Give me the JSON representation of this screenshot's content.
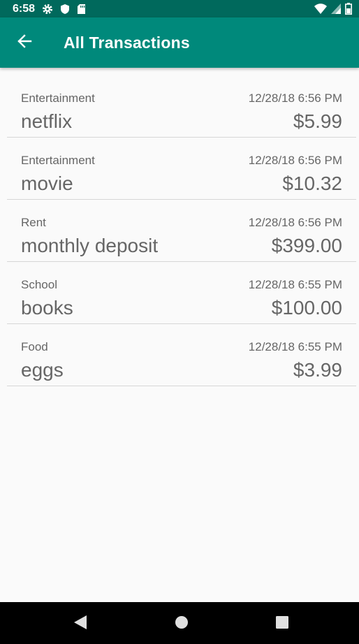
{
  "status_bar": {
    "time": "6:58",
    "left_icons": [
      "gear-icon",
      "shield-icon",
      "sd-card-icon"
    ],
    "right_icons": [
      "wifi-icon",
      "signal-icon",
      "battery-icon"
    ]
  },
  "app_bar": {
    "title": "All Transactions",
    "back_icon": "arrow-back-icon",
    "color": "#00897b",
    "status_color": "#00695c"
  },
  "transactions": [
    {
      "category": "Entertainment",
      "date": "12/28/18 6:56 PM",
      "name": "netflix",
      "amount": "$5.99"
    },
    {
      "category": "Entertainment",
      "date": "12/28/18 6:56 PM",
      "name": "movie",
      "amount": "$10.32"
    },
    {
      "category": "Rent",
      "date": "12/28/18 6:56 PM",
      "name": "monthly deposit",
      "amount": "$399.00"
    },
    {
      "category": "School",
      "date": "12/28/18 6:55 PM",
      "name": "books",
      "amount": "$100.00"
    },
    {
      "category": "Food",
      "date": "12/28/18 6:55 PM",
      "name": "eggs",
      "amount": "$3.99"
    }
  ],
  "nav_bar": {
    "buttons": [
      "back-triangle-icon",
      "home-circle-icon",
      "recents-square-icon"
    ]
  }
}
